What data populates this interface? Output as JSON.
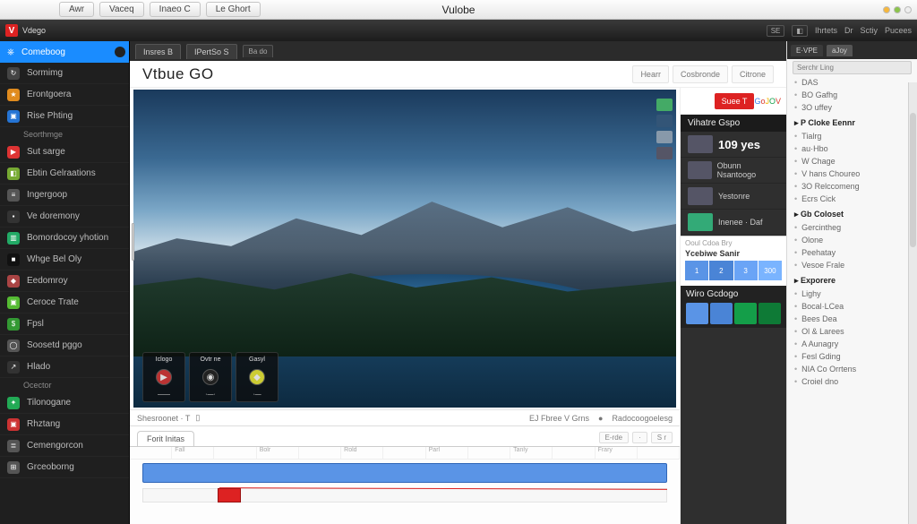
{
  "menubar": {
    "center_title": "Vulobe",
    "items": [
      "Awr",
      "Vaceq",
      "Inaeo C",
      "Le Ghort"
    ]
  },
  "toolbar": {
    "brand_letter": "V",
    "brand_text": "Vdego",
    "right_items": [
      "SE",
      "Ihrtets",
      "Dr",
      "Sctiy",
      "Pucees"
    ]
  },
  "sidebar": {
    "primary": "Comeboog",
    "items": [
      {
        "icon_bg": "#444",
        "icon": "↻",
        "label": "Sormimg"
      },
      {
        "icon_bg": "#e08b1e",
        "icon": "★",
        "label": "Erontgoera"
      },
      {
        "icon_bg": "#2574d4",
        "icon": "▣",
        "label": "Rise Phting",
        "sub": "Seorthmge"
      },
      {
        "icon_bg": "#d33",
        "icon": "▶",
        "label": "Sut sarge"
      },
      {
        "icon_bg": "#7a3",
        "icon": "◧",
        "label": "Ebtin Gelraations"
      },
      {
        "icon_bg": "#555",
        "icon": "≡",
        "label": "Ingergoop"
      },
      {
        "icon_bg": "#333",
        "icon": "▪",
        "label": "Ve doremony"
      },
      {
        "icon_bg": "#2a6",
        "icon": "▥",
        "label": "Bomordocoy yhotion"
      },
      {
        "icon_bg": "#111",
        "icon": "■",
        "label": "Whge Bel Oly"
      },
      {
        "icon_bg": "#a44",
        "icon": "◆",
        "label": "Eedomroy"
      },
      {
        "icon_bg": "#5b3",
        "icon": "▣",
        "label": "Ceroce Trate"
      },
      {
        "icon_bg": "#393",
        "icon": "$",
        "label": "Fpsl"
      },
      {
        "icon_bg": "#555",
        "icon": "◯",
        "label": "Soosetd pggo"
      },
      {
        "icon_bg": "#333",
        "icon": "↗",
        "label": "Hlado",
        "sub": "Ocector"
      },
      {
        "icon_bg": "#2a5",
        "icon": "✦",
        "label": "Tilonogane"
      },
      {
        "icon_bg": "#c33",
        "icon": "▣",
        "label": "Rhztang"
      },
      {
        "icon_bg": "#555",
        "icon": "≣",
        "label": "Cemengorcon"
      },
      {
        "icon_bg": "#555",
        "icon": "⊞",
        "label": "Grceoborng"
      }
    ]
  },
  "tabs": {
    "items": [
      "Insres B",
      "IPertSo S",
      "Ba do"
    ]
  },
  "header": {
    "title": "Vtbue GO",
    "nav": [
      "Hearr",
      "Cosbronde",
      "Citrone"
    ],
    "accent": "Suee T"
  },
  "preview": {
    "cards": [
      {
        "top": "Iclogo",
        "mid": "▶",
        "dot_bg": "#b33",
        "bot": "——"
      },
      {
        "top": "Ovtr ne",
        "mid": "◉",
        "dot_bg": "#222",
        "bot": "·—·"
      },
      {
        "top": "Gasyl",
        "mid": "◆",
        "dot_bg": "#cc3",
        "bot": "·—"
      }
    ],
    "thumbs": [
      "#4a6",
      "#357",
      "#89a",
      "#556"
    ]
  },
  "status": {
    "left": "Shesroonet · T",
    "right1": "EJ Fbree V Grns",
    "right2": "Radocoogoelesg"
  },
  "timeline": {
    "tab": "Forit Initas",
    "btns": [
      "E-rde",
      "·",
      "S r"
    ],
    "ruler": [
      "",
      "Fall",
      "",
      "Bolr",
      "",
      "Rold",
      "",
      "Parl",
      "",
      "Tanly",
      "",
      "Frary",
      ""
    ]
  },
  "rightcol": {
    "title1": "Vihatre Gspo",
    "views": "109 yes",
    "line1": "Obunn Nsantoogo",
    "line2": "Yestonre",
    "line3": "Inenee · Daf",
    "panel2_title": "Ycebiwe Sanir",
    "panel2_hint": "Ooul Cdoa Bry",
    "grid": [
      {
        "c": "#5a94e6",
        "t": "1"
      },
      {
        "c": "#4a84d6",
        "t": "2"
      },
      {
        "c": "#6aa4f6",
        "t": "3"
      },
      {
        "c": "#7ab4ff",
        "t": "300"
      }
    ],
    "panel3_title": "Wiro Gcdogo",
    "swatches": [
      "#5a94e6",
      "#4a84d6",
      "#149e49",
      "#0e7a36"
    ]
  },
  "farright": {
    "tabs": [
      "E·VPE",
      "aJoy"
    ],
    "search": "Serchr  Ling",
    "groups": [
      {
        "h": "",
        "items": [
          "DAS",
          "BO Gafhg",
          "3O uffey"
        ]
      },
      {
        "h": "P Cloke Eennr",
        "items": [
          "Tialrg",
          "au·Hbo",
          "W Chage",
          "V hans Choureo",
          "3O Relccomeng",
          "Ecrs Cick"
        ]
      },
      {
        "h": "Gb Coloset",
        "items": [
          "Gercintheg",
          "Olone",
          "Peehatay",
          "Vesoe  Frale"
        ]
      },
      {
        "h": "Exporere",
        "items": [
          "Lighy",
          "Bocal·LCea",
          "Bees Dea"
        ]
      },
      {
        "h": "",
        "items": [
          "Ol & Larees",
          "A Aunagry",
          "Fesl Gding"
        ]
      },
      {
        "h": "",
        "items": [
          "NIA Co Orrtens",
          "Croiel dno"
        ]
      }
    ]
  }
}
